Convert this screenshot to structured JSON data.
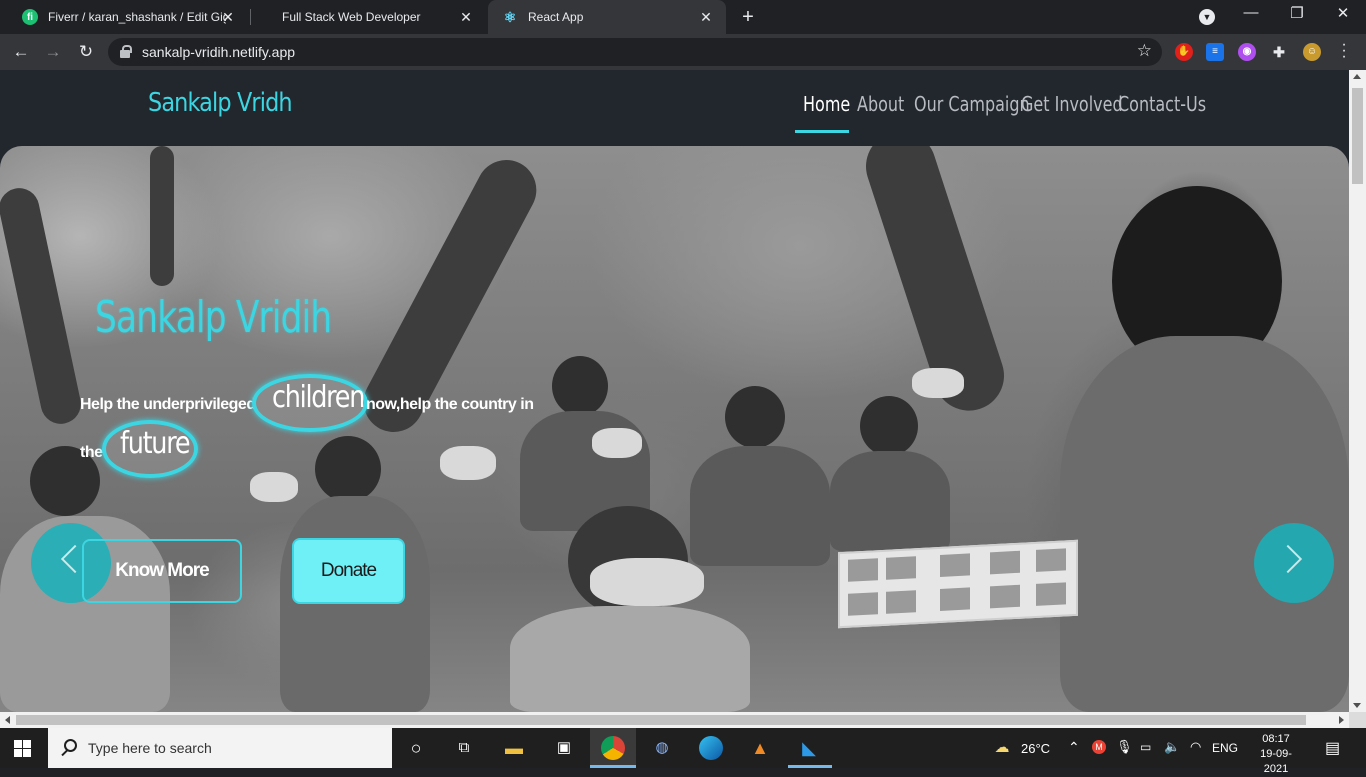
{
  "browser": {
    "tabs": [
      {
        "title": "Fiverr / karan_shashank / Edit Gig",
        "favicon": "fiverr-logo",
        "active": false
      },
      {
        "title": "Full Stack Web Developer",
        "favicon": "none",
        "active": false
      },
      {
        "title": "React App",
        "favicon": "react-logo",
        "active": true
      }
    ],
    "url": "sankalp-vridih.netlify.app"
  },
  "site": {
    "brand": "Sankalp Vridh",
    "nav": [
      {
        "label": "Home",
        "active": true
      },
      {
        "label": "About",
        "active": false
      },
      {
        "label": "Our Campaign",
        "active": false
      },
      {
        "label": "Get Involved",
        "active": false
      },
      {
        "label": "Contact-Us",
        "active": false
      }
    ],
    "hero": {
      "title": "Sankalp Vridih",
      "text_part1": "Help the underprivileged",
      "word1": "children",
      "text_part2": "now,help the country in",
      "text_part3": "the",
      "word2": "future",
      "know_more": "Know More",
      "donate": "Donate"
    }
  },
  "taskbar": {
    "search_placeholder": "Type here to search",
    "weather": "26°C",
    "language": "ENG",
    "time": "08:17",
    "date": "19-09-2021"
  },
  "colors": {
    "accent": "#3cd5e2",
    "donate_bg": "#6ff0f7",
    "navbar_bg": "#22272d"
  }
}
